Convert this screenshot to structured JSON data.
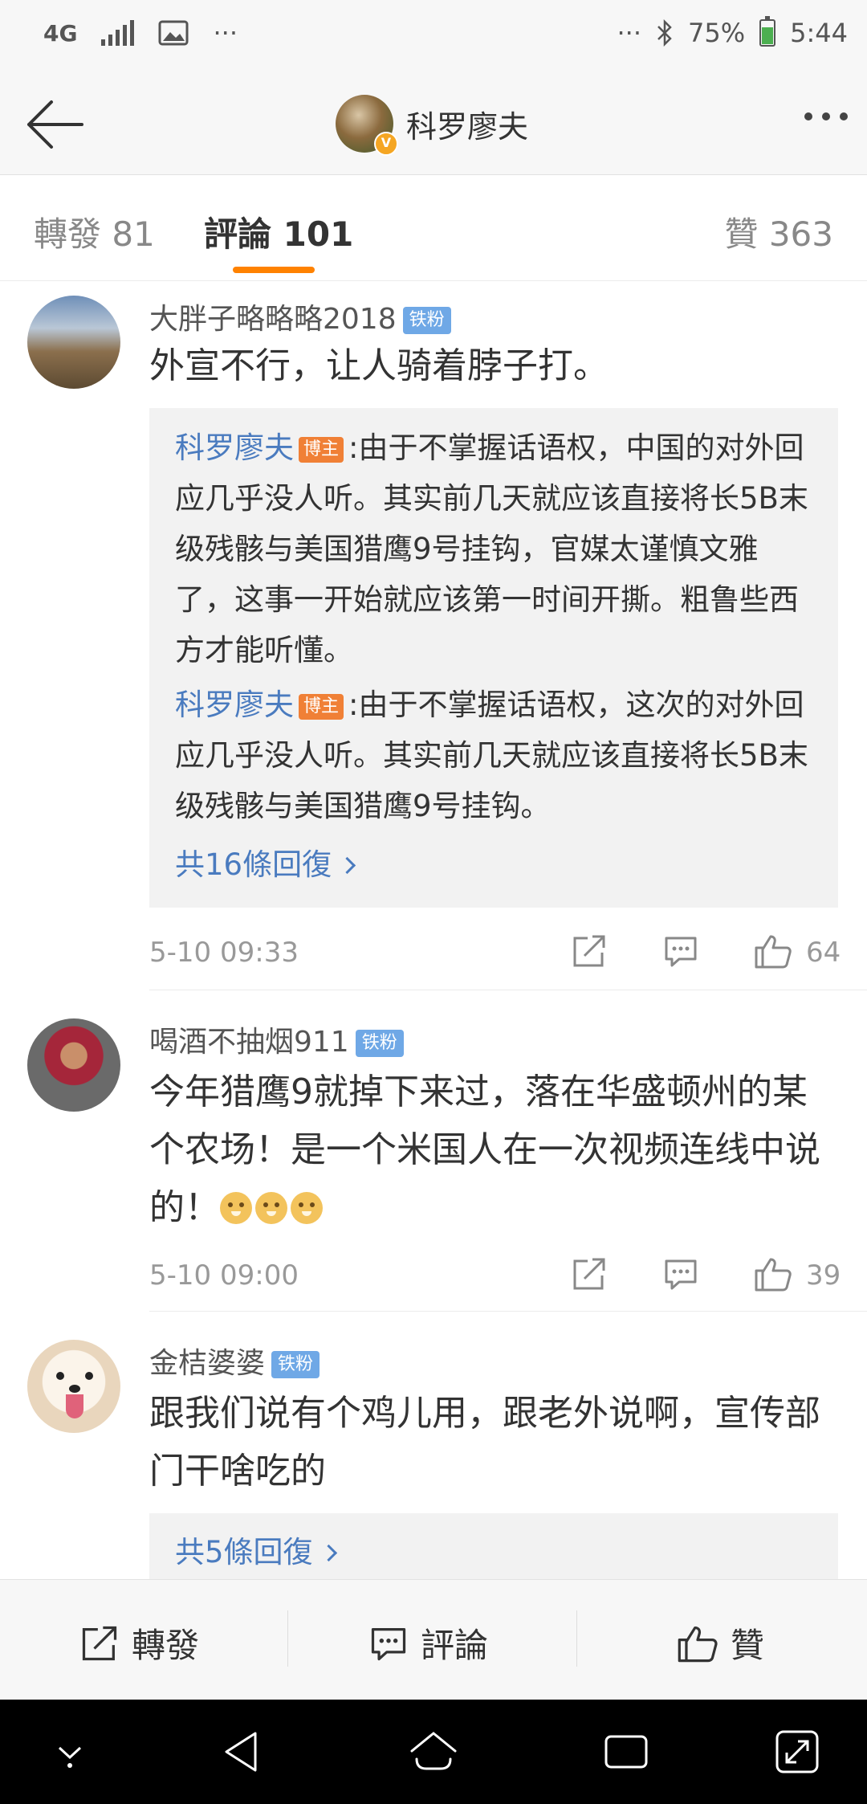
{
  "status_bar": {
    "network": "4G",
    "more_left": "···",
    "more_right": "···",
    "battery": "75%",
    "time": "5:44"
  },
  "header": {
    "title": "科罗廖夫"
  },
  "tabs": [
    {
      "label": "轉發",
      "count": "81"
    },
    {
      "label": "評論",
      "count": "101",
      "active": true
    },
    {
      "label": "贊",
      "count": "363"
    }
  ],
  "comments": [
    {
      "username": "大胖子略略略2018",
      "badge": "铁粉",
      "text": "外宣不行，让人骑着脖子打。",
      "replies": [
        {
          "user": "科罗廖夫",
          "badge": "博主",
          "text": ":由于不掌握话语权，中国的对外回应几乎没人听。其实前几天就应该直接将长5B末级残骸与美国猎鹰9号挂钩，官媒太谨慎文雅了，这事一开始就应该第一时间开撕。粗鲁些西方才能听懂。"
        },
        {
          "user": "科罗廖夫",
          "badge": "博主",
          "text": ":由于不掌握话语权，这次的对外回应几乎没人听。其实前几天就应该直接将长5B末级残骸与美国猎鹰9号挂钩。"
        }
      ],
      "more_replies": "共16條回復",
      "time": "5-10 09:33",
      "likes": "64"
    },
    {
      "username": "喝酒不抽烟911",
      "badge": "铁粉",
      "text": "今年猎鹰9就掉下来过，落在华盛顿州的某个农场！是一个米国人在一次视频连线中说的！",
      "time": "5-10 09:00",
      "likes": "39"
    },
    {
      "username": "金桔婆婆",
      "badge": "铁粉",
      "text": "跟我们说有个鸡儿用，跟老外说啊，宣传部门干啥吃的",
      "more_replies": "共5條回復"
    }
  ],
  "action_bar": {
    "repost": "轉發",
    "comment": "評論",
    "like": "贊"
  },
  "colors": {
    "accent": "#ff8200",
    "link": "#4a7bbf",
    "fan_badge": "#6fa8e6",
    "blogger_badge": "#f08036"
  },
  "icons": [
    "back-arrow-icon",
    "more-dots-icon",
    "share-icon",
    "comment-icon",
    "like-icon",
    "chevron-right-icon"
  ]
}
